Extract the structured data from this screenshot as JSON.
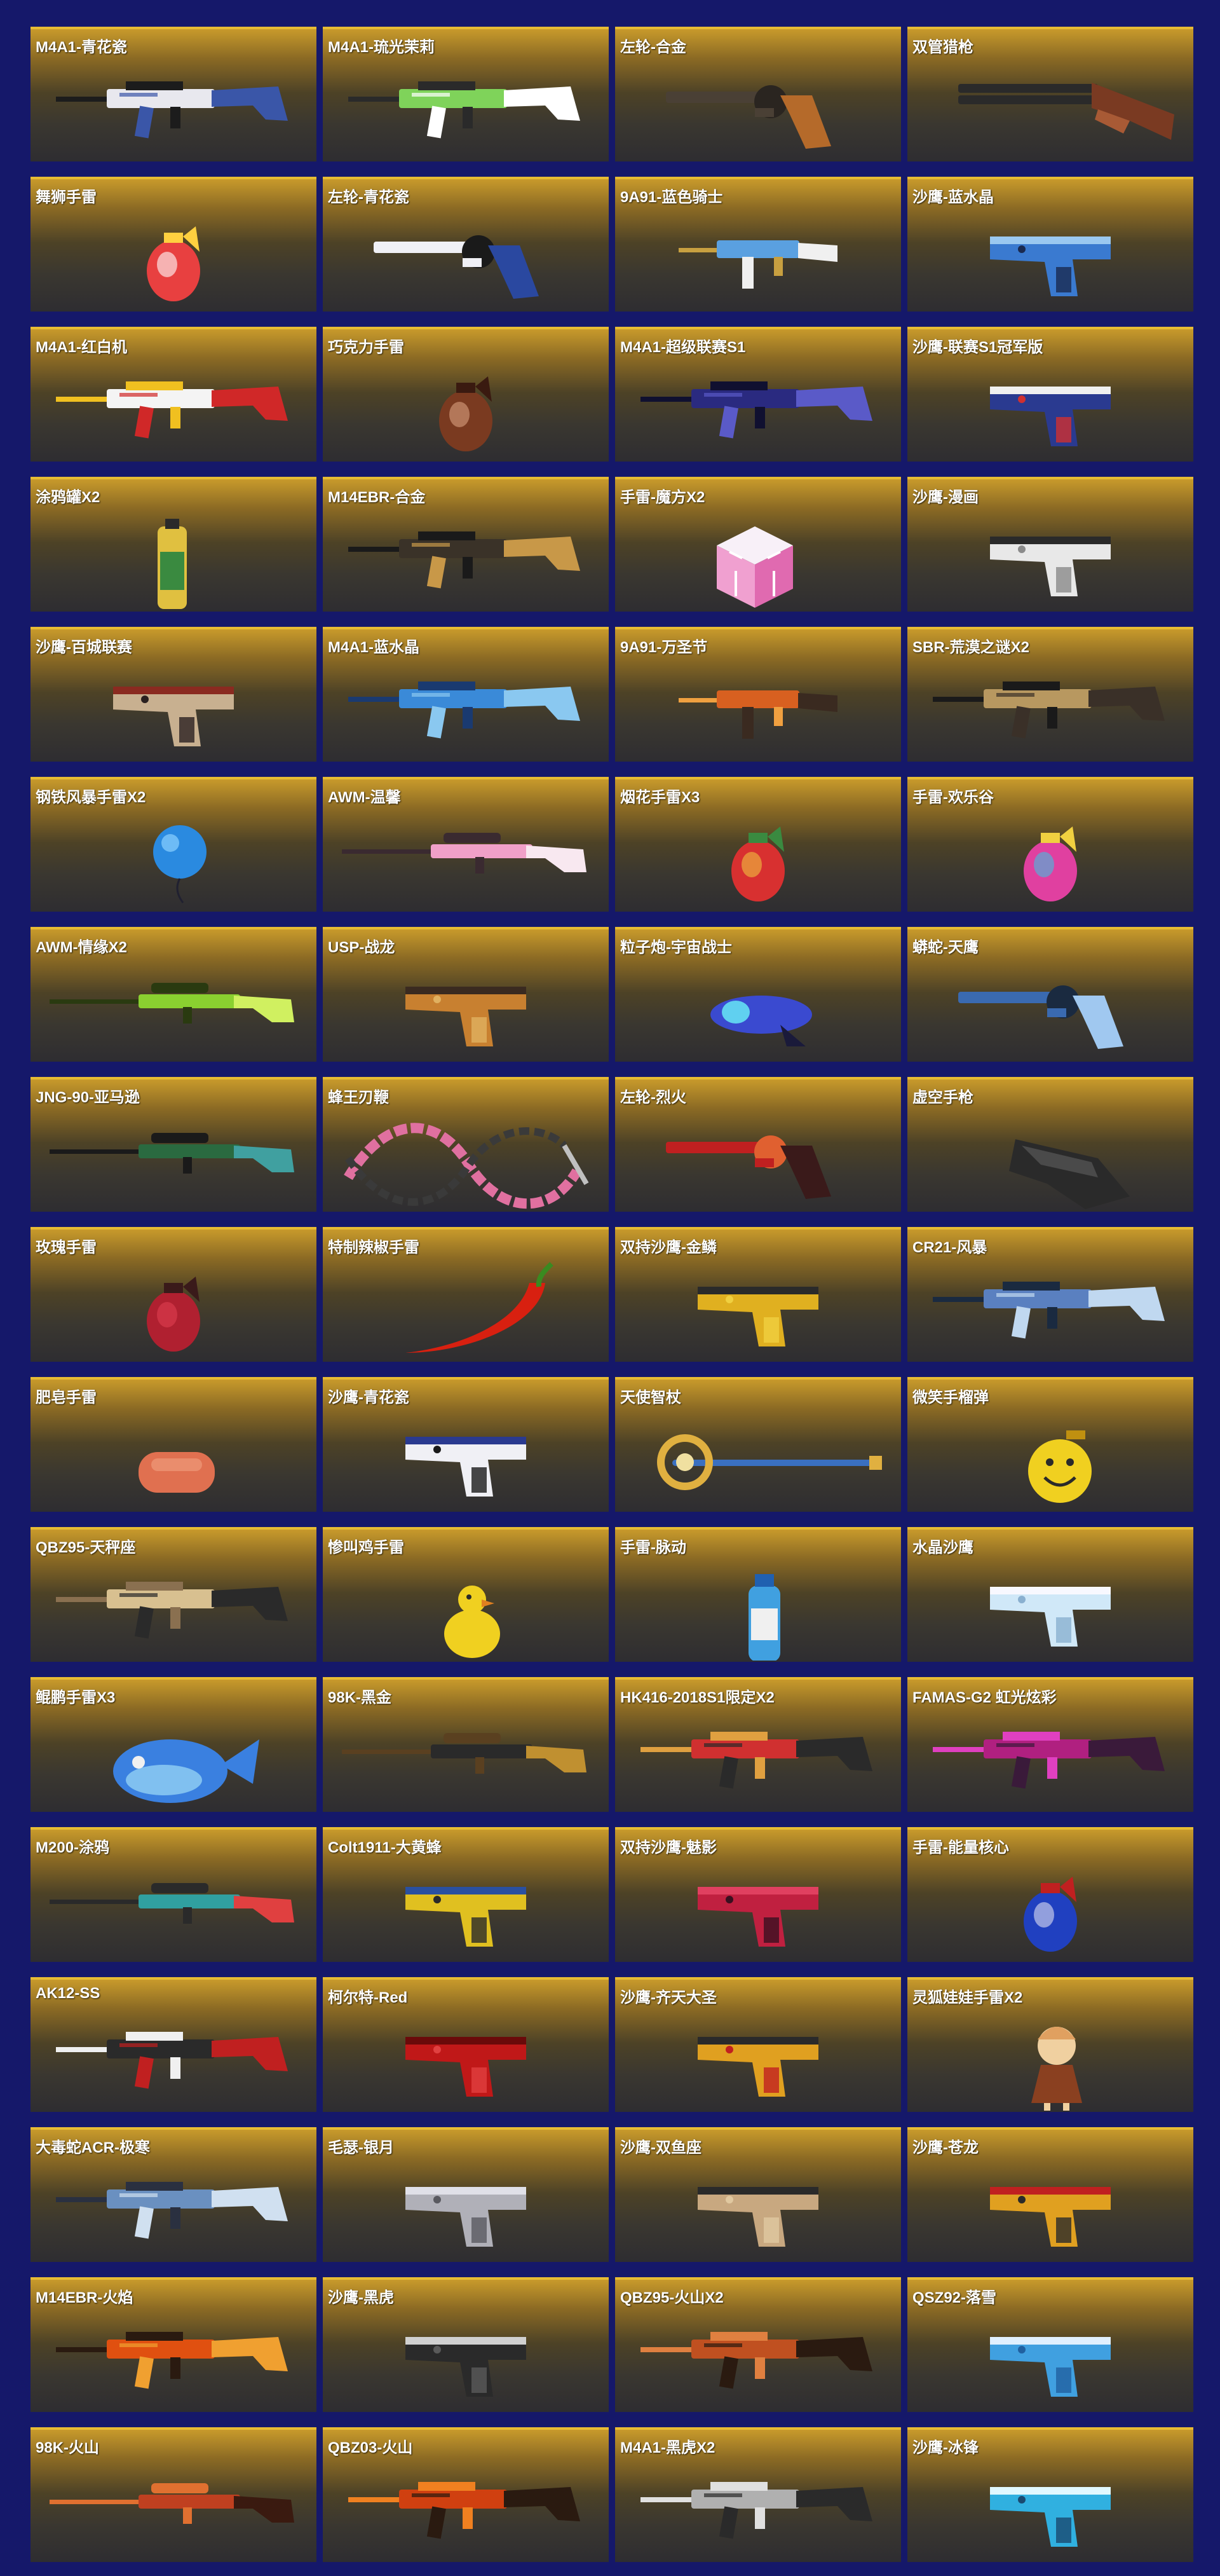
{
  "items": [
    {
      "name": "M4A1-青花瓷",
      "icon": "rifle-icon",
      "colors": [
        "#e8e8ee",
        "#3a56a8",
        "#1c1c1c"
      ]
    },
    {
      "name": "M4A1-琉光茉莉",
      "icon": "rifle-icon",
      "colors": [
        "#7fd35a",
        "#ffffff",
        "#2a2a2a"
      ]
    },
    {
      "name": "左轮-合金",
      "icon": "revolver-icon",
      "colors": [
        "#4a4035",
        "#b56a2a",
        "#2a2520"
      ]
    },
    {
      "name": "双管猎枪",
      "icon": "shotgun-icon",
      "colors": [
        "#7a3a22",
        "#2a2a2a",
        "#a85a35"
      ]
    },
    {
      "name": "舞狮手雷",
      "icon": "grenade-icon",
      "colors": [
        "#e84040",
        "#ffffff",
        "#ffd040"
      ]
    },
    {
      "name": "左轮-青花瓷",
      "icon": "revolver-icon",
      "colors": [
        "#f0f0f5",
        "#2a48a0",
        "#1a1a1a"
      ]
    },
    {
      "name": "9A91-蓝色骑士",
      "icon": "smg-icon",
      "colors": [
        "#5aa0e0",
        "#f0f0f0",
        "#c8a040"
      ]
    },
    {
      "name": "沙鹰-蓝水晶",
      "icon": "pistol-icon",
      "colors": [
        "#3a7ad0",
        "#9ac8f0",
        "#1a2a50"
      ]
    },
    {
      "name": "M4A1-红白机",
      "icon": "rifle-icon",
      "colors": [
        "#f4f4f4",
        "#d02828",
        "#f0c020"
      ]
    },
    {
      "name": "巧克力手雷",
      "icon": "grenade-icon",
      "colors": [
        "#7a3a20",
        "#d8a080",
        "#3a1a10"
      ]
    },
    {
      "name": "M4A1-超级联赛S1",
      "icon": "rifle-icon",
      "colors": [
        "#2a2a80",
        "#5a5ac8",
        "#101030"
      ]
    },
    {
      "name": "沙鹰-联赛S1冠军版",
      "icon": "pistol-icon",
      "colors": [
        "#2a3a90",
        "#f0f0f0",
        "#d03030"
      ]
    },
    {
      "name": "涂鸦罐X2",
      "icon": "spray-can-icon",
      "colors": [
        "#e0c040",
        "#3a8a40",
        "#2a2a2a"
      ]
    },
    {
      "name": "M14EBR-合金",
      "icon": "rifle-icon",
      "colors": [
        "#3a3228",
        "#c89848",
        "#1a1a1a"
      ]
    },
    {
      "name": "手雷-魔方X2",
      "icon": "cube-icon",
      "colors": [
        "#f0a0d0",
        "#f8f0f8",
        "#e06ab0"
      ]
    },
    {
      "name": "沙鹰-漫画",
      "icon": "pistol-icon",
      "colors": [
        "#e8e8e8",
        "#2a2a2a",
        "#8a8a8a"
      ]
    },
    {
      "name": "沙鹰-百城联赛",
      "icon": "pistol-icon",
      "colors": [
        "#c8b090",
        "#8a2a20",
        "#2a2020"
      ]
    },
    {
      "name": "M4A1-蓝水晶",
      "icon": "rifle-icon",
      "colors": [
        "#3a8ad8",
        "#8ac8f0",
        "#1a3a70"
      ]
    },
    {
      "name": "9A91-万圣节",
      "icon": "smg-icon",
      "colors": [
        "#d86020",
        "#3a2a20",
        "#f0a040"
      ]
    },
    {
      "name": "SBR-荒漠之谜X2",
      "icon": "rifle-icon",
      "colors": [
        "#b89860",
        "#3a3028",
        "#1a1a1a"
      ]
    },
    {
      "name": "钢铁风暴手雷X2",
      "icon": "balloon-icon",
      "colors": [
        "#2a8ae0",
        "#8ad0ff",
        "#202030"
      ]
    },
    {
      "name": "AWM-温馨",
      "icon": "sniper-icon",
      "colors": [
        "#f0a0c8",
        "#f8e8f0",
        "#3a2a30"
      ]
    },
    {
      "name": "烟花手雷X3",
      "icon": "grenade-icon",
      "colors": [
        "#d83030",
        "#f0c040",
        "#3a8a40"
      ]
    },
    {
      "name": "手雷-欢乐谷",
      "icon": "grenade-icon",
      "colors": [
        "#e040a0",
        "#40c0e0",
        "#f0d040"
      ]
    },
    {
      "name": "AWM-情缘X2",
      "icon": "sniper-icon",
      "colors": [
        "#8ad030",
        "#d0f060",
        "#2a3a10"
      ]
    },
    {
      "name": "USP-战龙",
      "icon": "pistol-icon",
      "colors": [
        "#c88030",
        "#3a2a20",
        "#e0b060"
      ]
    },
    {
      "name": "粒子炮-宇宙战士",
      "icon": "blaster-icon",
      "colors": [
        "#3a4ad0",
        "#60d0f0",
        "#1a1a3a"
      ]
    },
    {
      "name": "蟒蛇-天鹰",
      "icon": "revolver-icon",
      "colors": [
        "#3a6ab0",
        "#a0c8f0",
        "#1a2a40"
      ]
    },
    {
      "name": "JNG-90-亚马逊",
      "icon": "sniper-icon",
      "colors": [
        "#2a6a40",
        "#40a0a0",
        "#1a1a1a"
      ]
    },
    {
      "name": "蜂王刃鞭",
      "icon": "whip-icon",
      "colors": [
        "#e070a0",
        "#3a3a3a",
        "#c0c0c0"
      ]
    },
    {
      "name": "左轮-烈火",
      "icon": "revolver-icon",
      "colors": [
        "#c02020",
        "#3a1a1a",
        "#e06030"
      ]
    },
    {
      "name": "虚空手枪",
      "icon": "glove-icon",
      "colors": [
        "#2a2a2a",
        "#4a4a4a",
        "#101010"
      ]
    },
    {
      "name": "玫瑰手雷",
      "icon": "grenade-icon",
      "colors": [
        "#b02030",
        "#e04050",
        "#3a1a1a"
      ]
    },
    {
      "name": "特制辣椒手雷",
      "icon": "chili-icon",
      "colors": [
        "#d82010",
        "#f04020",
        "#3a8a20"
      ]
    },
    {
      "name": "双持沙鹰-金鳞",
      "icon": "pistol-icon",
      "colors": [
        "#e0b020",
        "#2a2a2a",
        "#f0d040"
      ]
    },
    {
      "name": "CR21-风暴",
      "icon": "rifle-icon",
      "colors": [
        "#5a80c0",
        "#c0d8f0",
        "#1a2a40"
      ]
    },
    {
      "name": "肥皂手雷",
      "icon": "soap-icon",
      "colors": [
        "#e07050",
        "#f0a080",
        "#c05030"
      ]
    },
    {
      "name": "沙鹰-青花瓷",
      "icon": "pistol-icon",
      "colors": [
        "#f0f0f5",
        "#2a3a90",
        "#1a1a1a"
      ]
    },
    {
      "name": "天使智杖",
      "icon": "staff-icon",
      "colors": [
        "#e0b040",
        "#3a70c0",
        "#f0e0a0"
      ]
    },
    {
      "name": "微笑手榴弹",
      "icon": "smiley-icon",
      "colors": [
        "#f0d020",
        "#2a2a2a",
        "#c09010"
      ]
    },
    {
      "name": "QBZ95-天秤座",
      "icon": "rifle-icon",
      "colors": [
        "#d8c090",
        "#2a2a2a",
        "#8a7050"
      ]
    },
    {
      "name": "惨叫鸡手雷",
      "icon": "chicken-icon",
      "colors": [
        "#f0d020",
        "#e08020",
        "#2a2a2a"
      ]
    },
    {
      "name": "手雷-脉动",
      "icon": "bottle-icon",
      "colors": [
        "#40a0e0",
        "#f0f0f0",
        "#2060b0"
      ]
    },
    {
      "name": "水晶沙鹰",
      "icon": "pistol-icon",
      "colors": [
        "#d0e8f8",
        "#f8f8ff",
        "#8ab0d0"
      ]
    },
    {
      "name": "鲲鹏手雷X3",
      "icon": "fish-icon",
      "colors": [
        "#3a80e0",
        "#80c0f0",
        "#f0f0f0"
      ]
    },
    {
      "name": "98K-黑金",
      "icon": "sniper-icon",
      "colors": [
        "#2a2a2a",
        "#c09030",
        "#5a4020"
      ]
    },
    {
      "name": "HK416-2018S1限定X2",
      "icon": "rifle-icon",
      "colors": [
        "#d03030",
        "#2a2a2a",
        "#e0a040"
      ]
    },
    {
      "name": "FAMAS-G2 虹光炫彩",
      "icon": "rifle-icon",
      "colors": [
        "#b02080",
        "#3a1a3a",
        "#e040c0"
      ]
    },
    {
      "name": "M200-涂鸦",
      "icon": "sniper-icon",
      "colors": [
        "#30a0a0",
        "#e04040",
        "#2a2a2a"
      ]
    },
    {
      "name": "Colt1911-大黄蜂",
      "icon": "pistol-icon",
      "colors": [
        "#e0c020",
        "#2a50a0",
        "#2a2a2a"
      ]
    },
    {
      "name": "双持沙鹰-魅影",
      "icon": "pistol-icon",
      "colors": [
        "#c02040",
        "#e04060",
        "#3a1020"
      ]
    },
    {
      "name": "手雷-能量核心",
      "icon": "grenade-icon",
      "colors": [
        "#2040c0",
        "#e0e0f0",
        "#c02020"
      ]
    },
    {
      "name": "AK12-SS",
      "icon": "rifle-icon",
      "colors": [
        "#2a2a2a",
        "#c02020",
        "#f0f0f0"
      ]
    },
    {
      "name": "柯尔特-Red",
      "icon": "pistol-icon",
      "colors": [
        "#c01818",
        "#6a0a0a",
        "#e04040"
      ]
    },
    {
      "name": "沙鹰-齐天大圣",
      "icon": "pistol-icon",
      "colors": [
        "#e0a020",
        "#2a2a2a",
        "#c02020"
      ]
    },
    {
      "name": "灵狐娃娃手雷X2",
      "icon": "doll-icon",
      "colors": [
        "#e0a060",
        "#f0d0a0",
        "#8a4020"
      ]
    },
    {
      "name": "大毒蛇ACR-极寒",
      "icon": "rifle-icon",
      "colors": [
        "#6a90c0",
        "#d0e0f0",
        "#2a3040"
      ]
    },
    {
      "name": "毛瑟-银月",
      "icon": "pistol-icon",
      "colors": [
        "#b0b0b8",
        "#e0e0e8",
        "#5a5a60"
      ]
    },
    {
      "name": "沙鹰-双鱼座",
      "icon": "pistol-icon",
      "colors": [
        "#c8a880",
        "#2a2a2a",
        "#e0c8a0"
      ]
    },
    {
      "name": "沙鹰-苍龙",
      "icon": "pistol-icon",
      "colors": [
        "#e0a020",
        "#c02020",
        "#2a2a2a"
      ]
    },
    {
      "name": "M14EBR-火焰",
      "icon": "rifle-icon",
      "colors": [
        "#e05010",
        "#f0a030",
        "#2a1a10"
      ]
    },
    {
      "name": "沙鹰-黑虎",
      "icon": "pistol-icon",
      "colors": [
        "#2a2a2a",
        "#d0d0d0",
        "#5a5a5a"
      ]
    },
    {
      "name": "QBZ95-火山X2",
      "icon": "rifle-icon",
      "colors": [
        "#c05020",
        "#2a1a10",
        "#e08040"
      ]
    },
    {
      "name": "QSZ92-落雪",
      "icon": "pistol-icon",
      "colors": [
        "#40a0e0",
        "#e0f0ff",
        "#2060a0"
      ]
    },
    {
      "name": "98K-火山",
      "icon": "sniper-icon",
      "colors": [
        "#c04020",
        "#3a1a10",
        "#e07030"
      ]
    },
    {
      "name": "QBZ03-火山",
      "icon": "rifle-icon",
      "colors": [
        "#d04010",
        "#2a1a10",
        "#f08020"
      ]
    },
    {
      "name": "M4A1-黑虎X2",
      "icon": "rifle-icon",
      "colors": [
        "#b0b0b0",
        "#2a2a2a",
        "#e0e0e0"
      ]
    },
    {
      "name": "沙鹰-冰锋",
      "icon": "pistol-icon",
      "colors": [
        "#30b0e0",
        "#e0f8ff",
        "#1a4a70"
      ]
    }
  ]
}
